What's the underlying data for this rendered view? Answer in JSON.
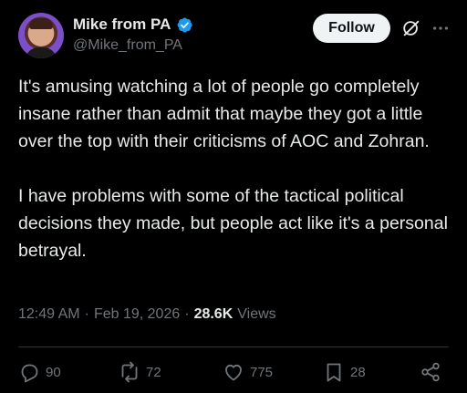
{
  "author": {
    "display_name": "Mike from PA",
    "handle": "@Mike_from_PA",
    "verified": true
  },
  "header": {
    "follow_label": "Follow"
  },
  "tweet": {
    "paragraphs": [
      "It's amusing watching a lot of people go completely insane rather than admit that maybe they got a little over the top with their criticisms of AOC and Zohran.",
      "I have problems with some of the tactical political decisions they made, but people act like it's a personal betrayal."
    ]
  },
  "meta": {
    "time": "12:49 AM",
    "separator": "·",
    "date": "Feb 19, 2026",
    "views_count": "28.6K",
    "views_label": "Views"
  },
  "actions": {
    "replies": "90",
    "reposts": "72",
    "likes": "775",
    "bookmarks": "28"
  },
  "colors": {
    "background": "#000000",
    "text": "#e7e9ea",
    "secondary_text": "#71767b",
    "verified_badge": "#1d9bf0",
    "follow_button_bg": "#eff3f4",
    "divider": "#2f3336"
  }
}
